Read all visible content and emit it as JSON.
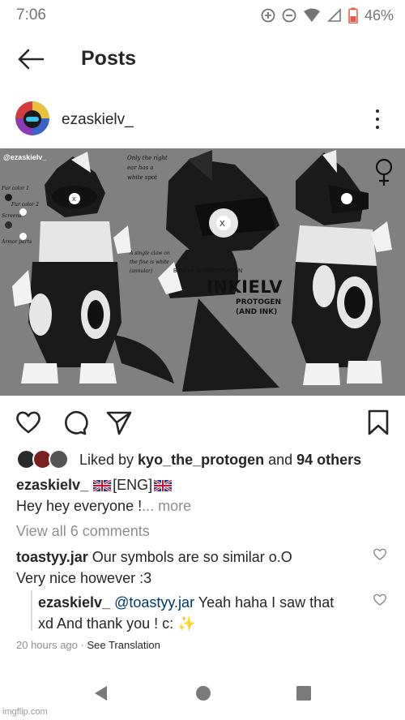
{
  "status_bar": {
    "time": "7:06",
    "battery": "46%"
  },
  "header": {
    "title": "Posts"
  },
  "post": {
    "username": "ezaskielv_",
    "image": {
      "watermark": "@ezaskielv_",
      "note_top": [
        "Only the right",
        "ear has a",
        "white spot"
      ],
      "note_claw": [
        "A single claw on",
        "the fine is white",
        "(annular)"
      ],
      "base_credit": "Base by SUMARIDRAGON",
      "labels": [
        "Fur color 1",
        "Fur color 2",
        "Screens",
        "Armor parts"
      ],
      "character_name": "INKIELV",
      "species": [
        "PROTOGEN",
        "(AND INK)"
      ],
      "colors": {
        "background": "#808080",
        "fur1": "#1a1a1a",
        "fur2": "#2e2e2e",
        "screens": "#ffffff",
        "armor": "#e6e6e6"
      }
    },
    "likes": {
      "prefix": "Liked by ",
      "user": "kyo_the_protogen",
      "middle": " and ",
      "others": "94 others"
    },
    "caption": {
      "username": "ezaskielv_",
      "lang_tag": "[ENG]",
      "text": "Hey hey everyone !",
      "more": "... more"
    },
    "view_comments": "View all 6 comments",
    "comments": [
      {
        "username": "toastyy.jar",
        "line1": " Our symbols are so similar o.O",
        "line2": "Very nice however :3"
      },
      {
        "username": "ezaskielv_",
        "mention": "@toastyy.jar",
        "line1": " Yeah haha I saw that",
        "line2": "xd And thank you ! c: ",
        "emoji": "✨"
      }
    ],
    "timestamp": "20 hours ago",
    "separator": " · ",
    "see_translation": "See Translation"
  },
  "watermark_footer": "imgflip.com",
  "icons": [
    "back-arrow-icon",
    "heart-icon",
    "comment-icon",
    "share-icon",
    "bookmark-icon",
    "more-vertical-icon"
  ]
}
